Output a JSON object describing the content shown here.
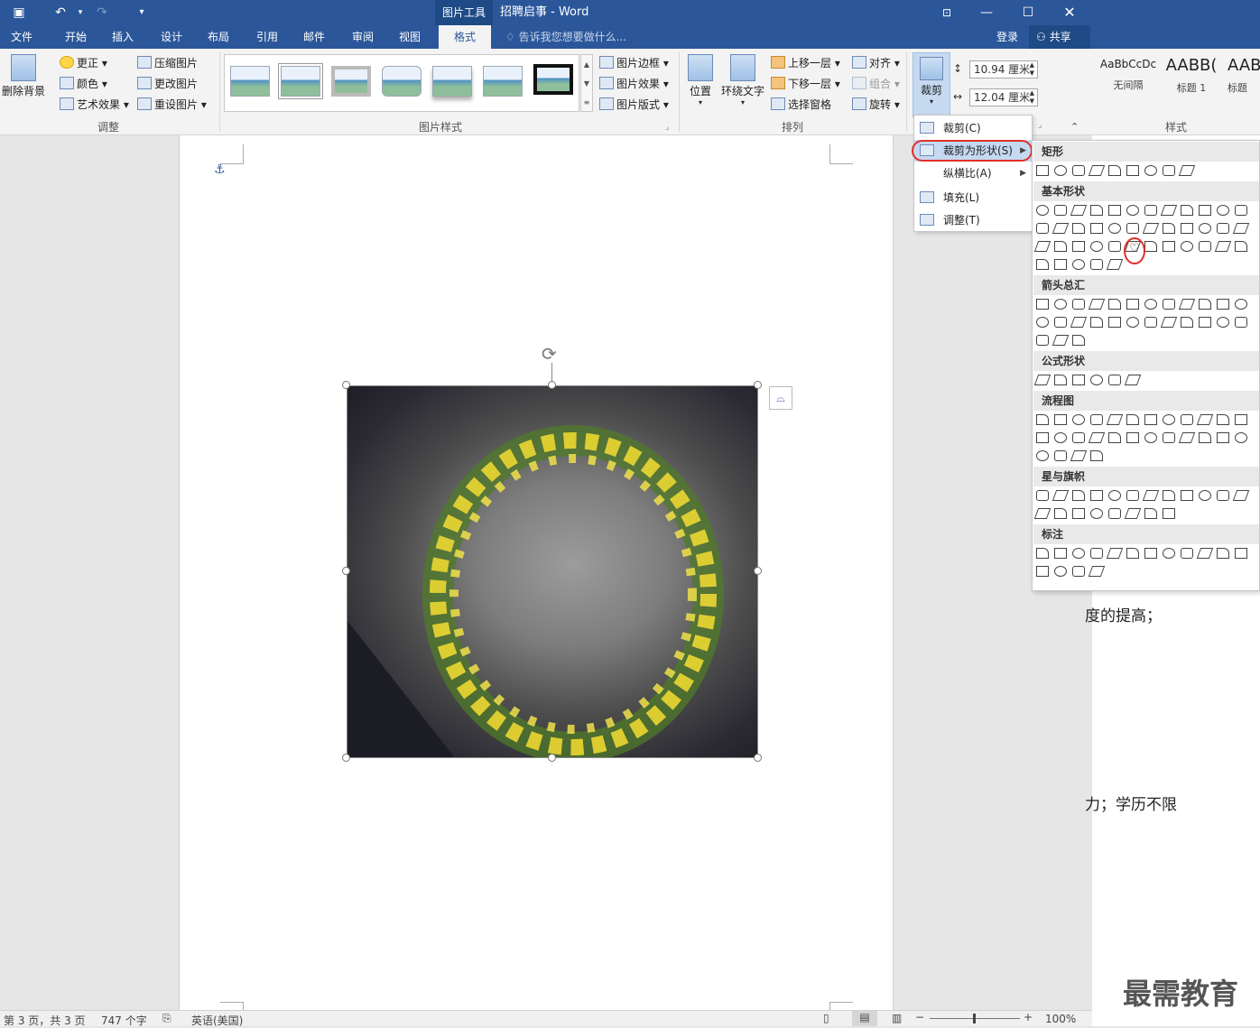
{
  "titlebar": {
    "title": "招聘启事 - Word",
    "context_tab": "图片工具",
    "qa_save": "save-icon",
    "qa_undo": "undo-icon",
    "qa_redo": "redo-icon",
    "qa_more": "customize-icon"
  },
  "tabs": [
    "文件",
    "开始",
    "插入",
    "设计",
    "布局",
    "引用",
    "邮件",
    "审阅",
    "视图",
    "格式"
  ],
  "tell_me": "告诉我您想要做什么...",
  "login": "登录",
  "share": "共享",
  "ribbon": {
    "remove_bg": "删除背景",
    "corrections": "更正",
    "color": "颜色",
    "artistic": "艺术效果",
    "compress": "压缩图片",
    "change_pic": "更改图片",
    "reset_pic": "重设图片",
    "group_adjust": "调整",
    "pic_border": "图片边框",
    "pic_effects": "图片效果",
    "pic_layout": "图片版式",
    "group_styles": "图片样式",
    "position": "位置",
    "wrap_text": "环绕文字",
    "bring_forward": "上移一层",
    "send_backward": "下移一层",
    "selection_pane": "选择窗格",
    "align": "对齐",
    "group": "组合",
    "rotate": "旋转",
    "group_arrange": "排列",
    "crop": "裁剪",
    "height": "10.94 厘米",
    "width": "12.04 厘米",
    "style1_sample": "AaBbCcDc",
    "style1_name": "无间隔",
    "style2_sample": "AABB(",
    "style2_name": "标题 1",
    "style3_sample": "AABI",
    "style3_name": "标题",
    "group_style": "样式"
  },
  "crop_menu": {
    "crop": "裁剪(C)",
    "crop_to_shape": "裁剪为形状(S)",
    "aspect_ratio": "纵横比(A)",
    "fill": "填充(L)",
    "fit": "调整(T)"
  },
  "shape_categories": {
    "rect": "矩形",
    "basic": "基本形状",
    "arrows": "箭头总汇",
    "equation": "公式形状",
    "flowchart": "流程图",
    "stars": "星与旗帜",
    "callouts": "标注"
  },
  "doc_text": {
    "line1": "度的提高；",
    "line2": "力；学历不限"
  },
  "watermark": "最需教育",
  "status": {
    "page": "第 3 页，共 3 页",
    "words": "747 个字",
    "lang": "英语(美国)",
    "zoom": "100%"
  }
}
